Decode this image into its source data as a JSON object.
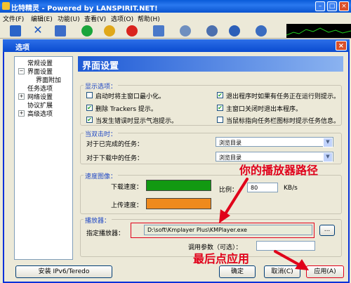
{
  "app": {
    "title": "比特精灵 - Powered by LANSPIRIT.NET!",
    "menu": [
      "文件(F)",
      "编辑(E)",
      "功能(U)",
      "查看(V)",
      "选项(O)",
      "帮助(H)"
    ]
  },
  "dialog": {
    "title": "选项",
    "tree": {
      "items": [
        "常规设置",
        "界面设置",
        "界面附加",
        "任务选项",
        "网络设置",
        "协议扩展",
        "高级选项"
      ]
    },
    "header": "界面设置",
    "display": {
      "legend": "显示选项：",
      "options": [
        {
          "label": "启动时将主窗口最小化。",
          "checked": false
        },
        {
          "label": "退出程序时如果有任务正在运行则提示。",
          "checked": true
        },
        {
          "label": "删除 Trackers 提示。",
          "checked": true
        },
        {
          "label": "主窗口关闭时退出本程序。",
          "checked": true
        },
        {
          "label": "当发生错误时显示气泡提示。",
          "checked": true
        },
        {
          "label": "当鼠标指向任务栏图标时提示任务信息。",
          "checked": false
        }
      ]
    },
    "dblclick": {
      "legend": "当双击时：",
      "completed_label": "对于已完成的任务：",
      "completed_value": "浏览目录",
      "downloading_label": "对于下载中的任务：",
      "downloading_value": "浏览目录"
    },
    "speed": {
      "legend": "速度图像：",
      "download_label": "下载速度：",
      "upload_label": "上传速度：",
      "download_color": "#129912",
      "upload_color": "#ef8a1d",
      "ratio_label": "比例：",
      "ratio_value": "80",
      "ratio_unit": "KB/s"
    },
    "player": {
      "legend": "播放器：",
      "label": "指定播放器：",
      "path": "D:\\soft\\Kmplayer Plus\\KMPlayer.exe",
      "browse": "...",
      "params_label": "调用参数（可选）："
    },
    "buttons": {
      "ipv6": "安装 IPv6/Teredo",
      "ok": "确定",
      "cancel": "取消(C)",
      "apply": "应用(A)"
    }
  },
  "annotations": {
    "player_path": "你的播放器路径",
    "apply_last": "最后点应用"
  }
}
